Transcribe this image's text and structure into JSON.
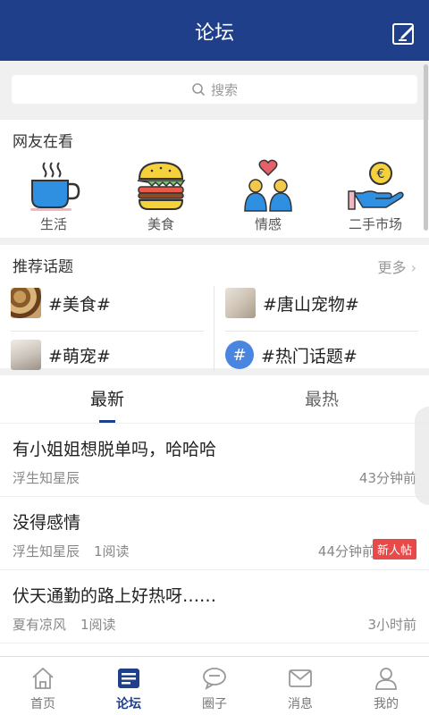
{
  "header": {
    "title": "论坛"
  },
  "search": {
    "placeholder": "搜索"
  },
  "browsing": {
    "title": "网友在看",
    "categories": [
      {
        "label": "生活",
        "icon": "coffee-cup-icon"
      },
      {
        "label": "美食",
        "icon": "burger-icon"
      },
      {
        "label": "情感",
        "icon": "couple-heart-icon"
      },
      {
        "label": "二手市场",
        "icon": "euro-coin-hand-icon"
      }
    ]
  },
  "topics": {
    "title": "推荐话题",
    "more": "更多",
    "items": [
      {
        "label": "#美食#"
      },
      {
        "label": "#唐山宠物#"
      },
      {
        "label": "#萌宠#"
      },
      {
        "label": "#热门话题#"
      }
    ]
  },
  "tabs": [
    {
      "label": "最新"
    },
    {
      "label": "最热"
    }
  ],
  "posts": [
    {
      "title": "有小姐姐想脱单吗，哈哈哈",
      "author": "浮生知星辰",
      "reads": "",
      "time": "43分钟前",
      "badge": ""
    },
    {
      "title": "没得感情",
      "author": "浮生知星辰",
      "reads": "1阅读",
      "time": "44分钟前",
      "badge": "新人帖"
    },
    {
      "title": "伏天通勤的路上好热呀……",
      "author": "夏有凉风",
      "reads": "1阅读",
      "time": "3小时前",
      "badge": ""
    }
  ],
  "nav": [
    {
      "label": "首页",
      "icon": "home-icon"
    },
    {
      "label": "论坛",
      "icon": "forum-icon"
    },
    {
      "label": "圈子",
      "icon": "chat-bubble-icon"
    },
    {
      "label": "消息",
      "icon": "mail-icon"
    },
    {
      "label": "我的",
      "icon": "person-icon"
    }
  ],
  "colors": {
    "primary": "#1f3f8a",
    "badge": "#e84a4a"
  }
}
